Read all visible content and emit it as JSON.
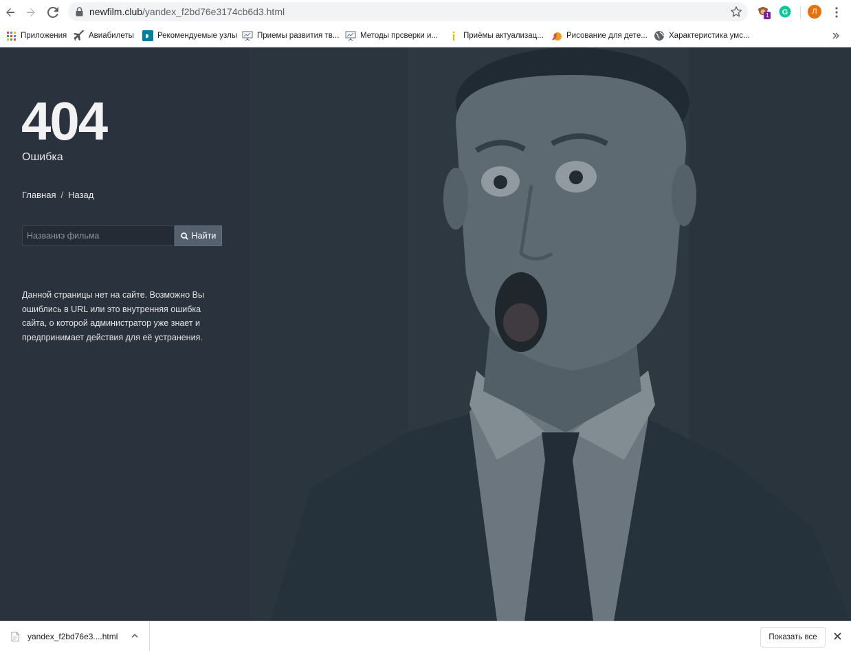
{
  "browser": {
    "url_host": "newfilm.club",
    "url_path": "/yandex_f2bd76e3174cb6d3.html",
    "extension_badge": "1",
    "profile_initial": "Л",
    "bookmarks": [
      {
        "label": "Приложения",
        "icon": "apps-grid-icon"
      },
      {
        "label": "Авиабилеты",
        "icon": "airplane-icon"
      },
      {
        "label": "Рекомендуемые узлы",
        "icon": "bing-icon"
      },
      {
        "label": "Приемы развития тв...",
        "icon": "presentation-icon"
      },
      {
        "label": "Методы прсверки и...",
        "icon": "presentation-icon"
      },
      {
        "label": "Приёмы актуализац...",
        "icon": "info-icon"
      },
      {
        "label": "Рисование для дете...",
        "icon": "drawing-icon"
      },
      {
        "label": "Характеристика умс...",
        "icon": "globe-icon"
      }
    ]
  },
  "page": {
    "error_code": "404",
    "error_label": "Ошибка",
    "breadcrumb": {
      "home": "Главная",
      "separator": "/",
      "back": "Назад"
    },
    "search": {
      "placeholder": "Названиэ фильма",
      "button": "Найти"
    },
    "description": "Данной страницы нет на сайте. Возможно Вы ошиблись в URL или это внутренняя ошибка сайта, о которой администратор уже знает и предпринимает действия для её устранения."
  },
  "downloads": {
    "file_name": "yandex_f2bd76e3....html",
    "show_all": "Показать все"
  },
  "colors": {
    "left_panel": "#2a323d",
    "photo_tint": "#3a464d",
    "search_button": "#56616f",
    "profile_avatar": "#e8710a"
  }
}
